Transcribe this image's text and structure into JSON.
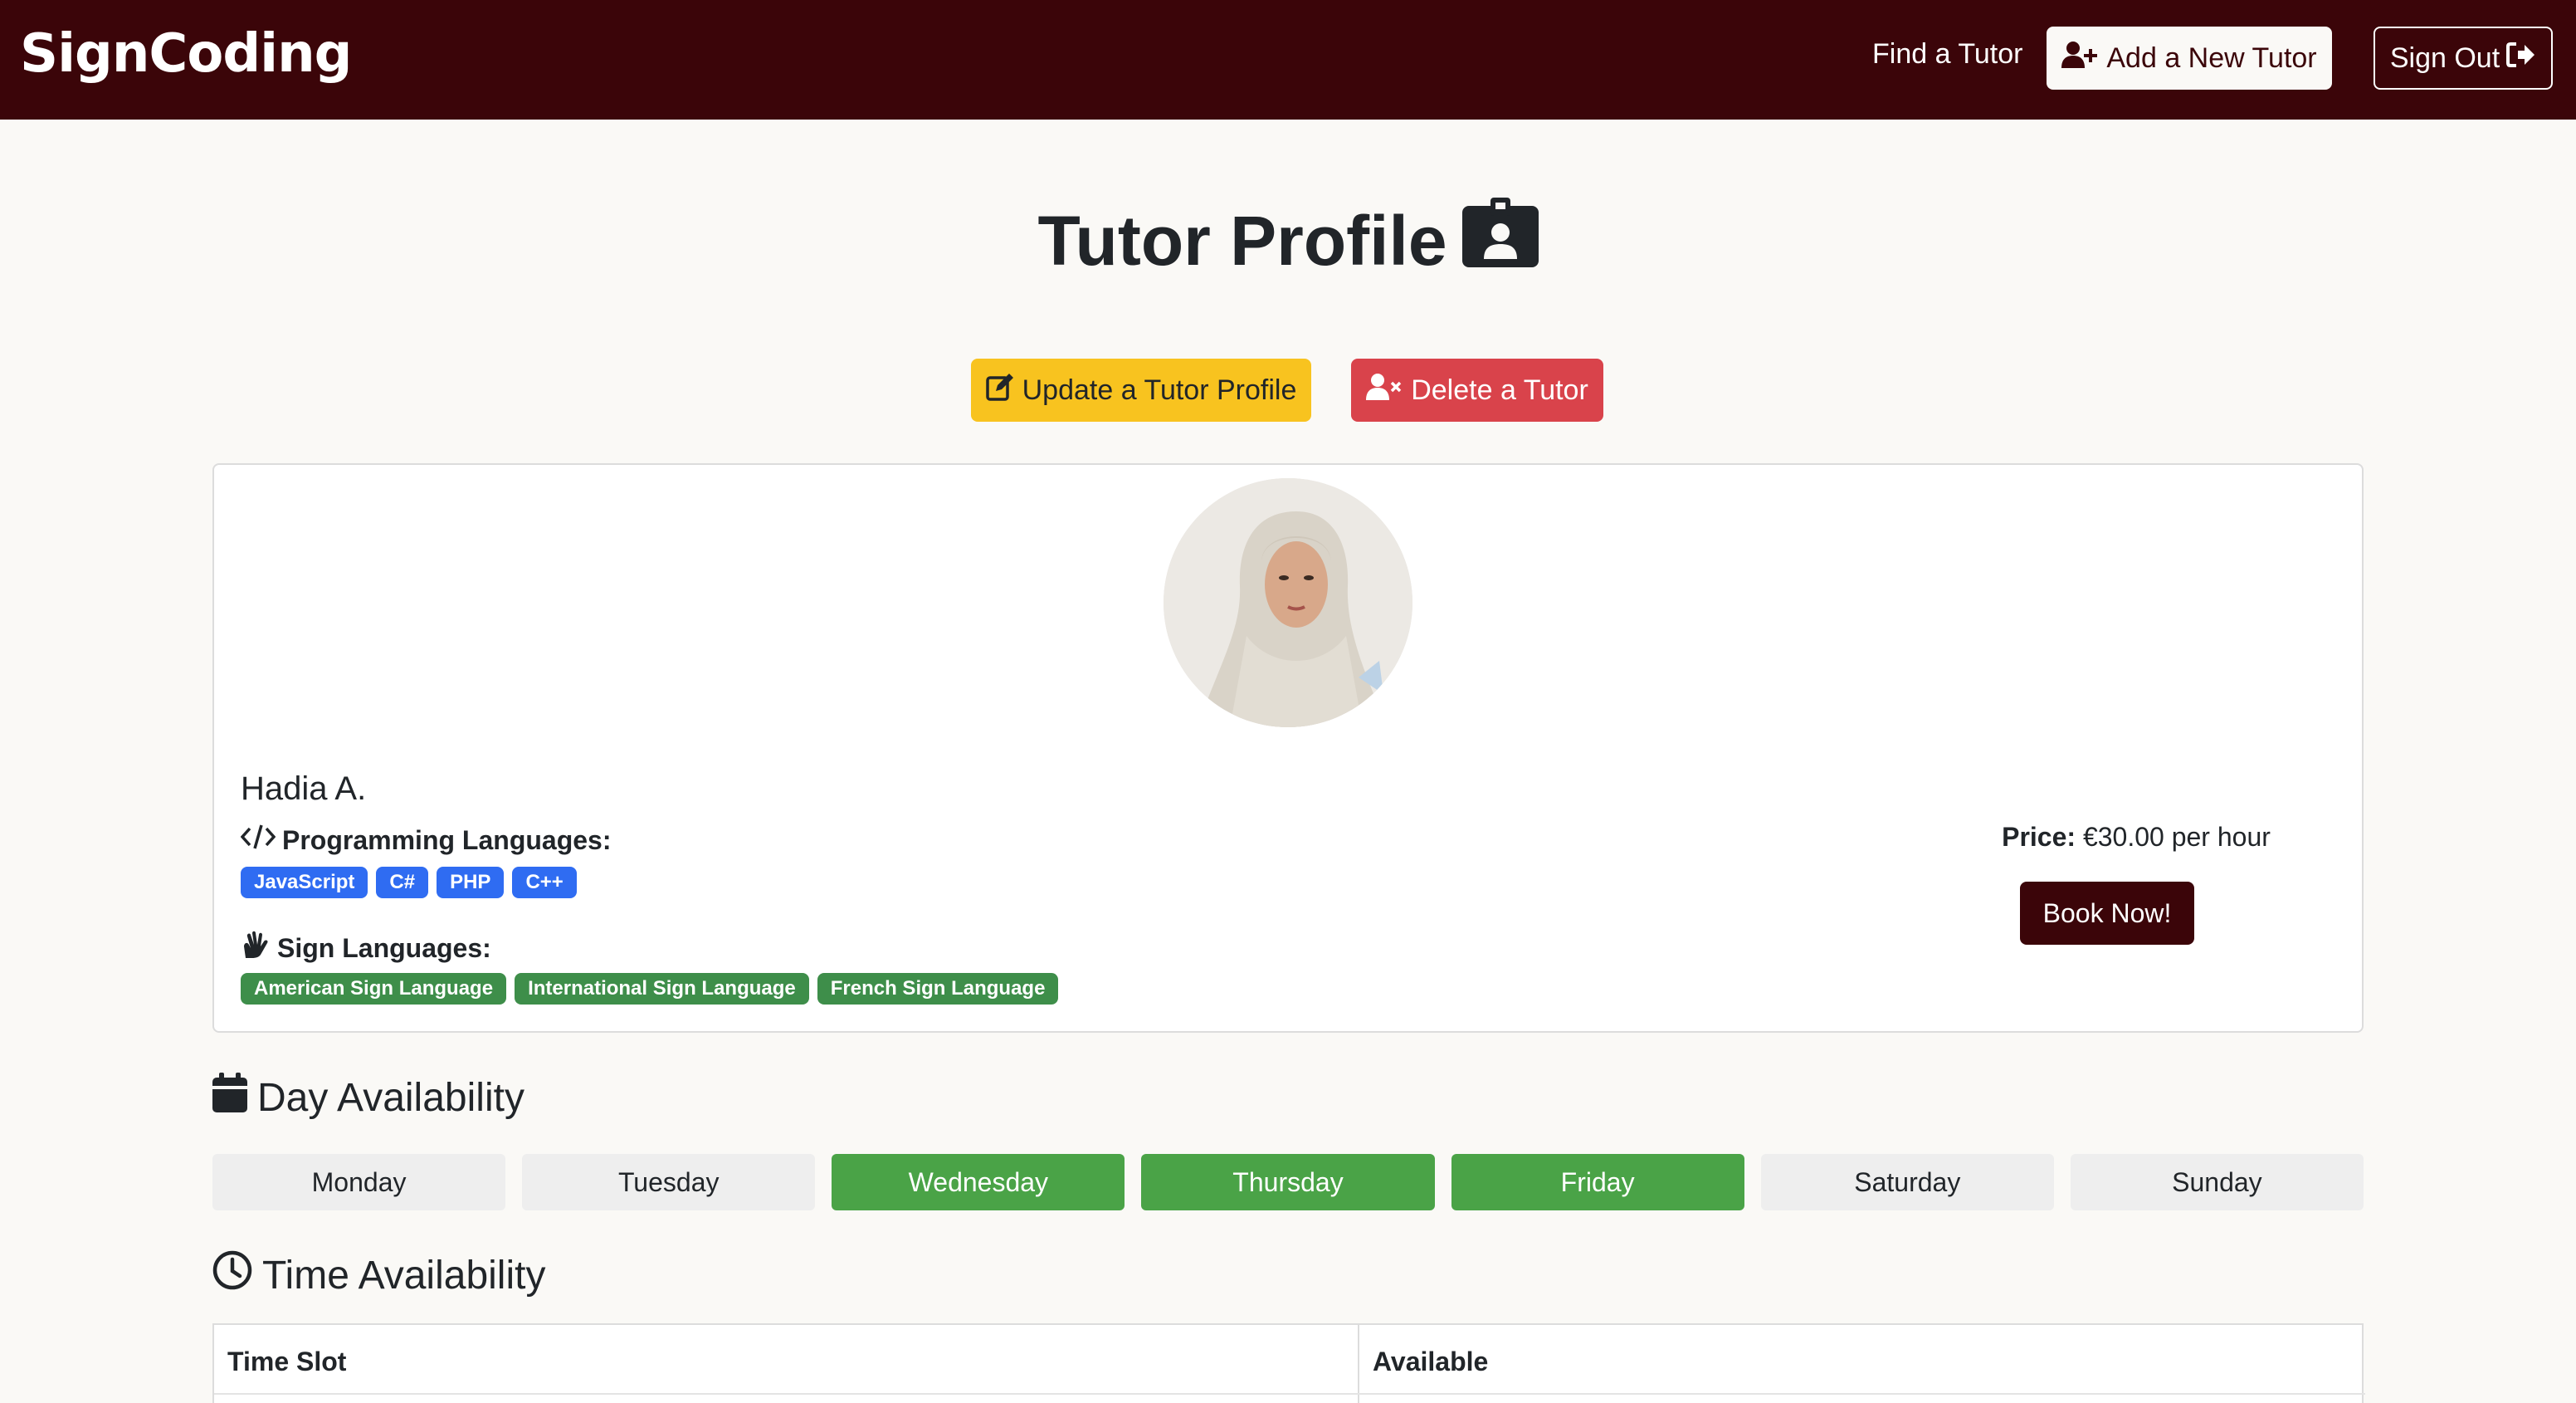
{
  "nav": {
    "brand": "SignCoding",
    "find_tutor": "Find a Tutor",
    "add_tutor": "Add a New Tutor",
    "sign_out": "Sign Out"
  },
  "page": {
    "title": "Tutor Profile",
    "update_button": "Update a Tutor Profile",
    "delete_button": "Delete a Tutor"
  },
  "tutor": {
    "name": "Hadia A.",
    "programming_label": "Programming Languages:",
    "programming_languages": [
      "JavaScript",
      "C#",
      "PHP",
      "C++"
    ],
    "sign_label": "Sign Languages:",
    "sign_languages": [
      "American Sign Language",
      "International Sign Language",
      "French Sign Language"
    ],
    "price_label": "Price:",
    "price_value": "€30.00 per hour",
    "book_button": "Book Now!"
  },
  "availability": {
    "day_heading": "Day Availability",
    "days": [
      "Monday",
      "Tuesday",
      "Wednesday",
      "Thursday",
      "Friday",
      "Saturday",
      "Sunday"
    ],
    "available_days": [
      "Wednesday",
      "Thursday",
      "Friday"
    ],
    "time_heading": "Time Availability",
    "table_headers": [
      "Time Slot",
      "Available"
    ]
  },
  "colors": {
    "navbar": "#3b0509",
    "update": "#f8c31f",
    "delete": "#d9434b",
    "badge_blue": "#2f6cf2",
    "badge_green": "#3e8e4a",
    "day_on": "#4aa347"
  },
  "icons": {
    "add_user": "user-plus-icon",
    "sign_out": "sign-out-icon",
    "title": "id-badge-icon",
    "update": "edit-icon",
    "delete": "user-xmark-icon",
    "code": "code-icon",
    "sign": "hands-signing-icon",
    "calendar": "calendar-icon",
    "clock": "clock-icon"
  }
}
